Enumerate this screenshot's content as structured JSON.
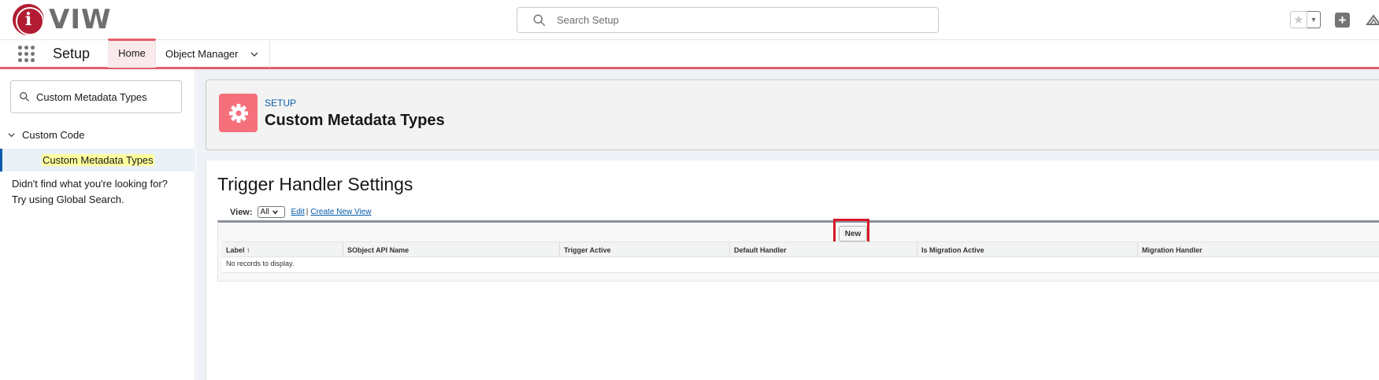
{
  "brand": {
    "logo_text": "VIW",
    "logo_glyph": "i",
    "accent_color": "#b11c32"
  },
  "global_search": {
    "placeholder": "Search Setup"
  },
  "header_actions": {
    "favorites_icon": "star-icon",
    "dropdown_icon": "chevron-down-icon",
    "add_icon": "plus-icon",
    "trail_icon": "trailhead-icon"
  },
  "nav": {
    "app_name": "Setup",
    "tabs": [
      {
        "label": "Home",
        "active": true
      },
      {
        "label": "Object Manager",
        "has_dropdown": true
      }
    ]
  },
  "sidebar": {
    "quick_find_value": "Custom Metadata Types",
    "group_label": "Custom Code",
    "item_label": "Custom Metadata Types",
    "help_line1": "Didn't find what you're looking for?",
    "help_line2": "Try using Global Search."
  },
  "page_header": {
    "breadcrumb": "SETUP",
    "title": "Custom Metadata Types",
    "icon": "gear-icon"
  },
  "list_view": {
    "title": "Trigger Handler Settings",
    "view_label": "View:",
    "view_selected": "All",
    "edit_link": "Edit",
    "separator": "|",
    "create_link": "Create New View",
    "new_button": "New",
    "columns": [
      "Label ↑",
      "SObject API Name",
      "Trigger Active",
      "Default Handler",
      "Is Migration Active",
      "Migration Handler"
    ],
    "empty_message": "No records to display."
  }
}
